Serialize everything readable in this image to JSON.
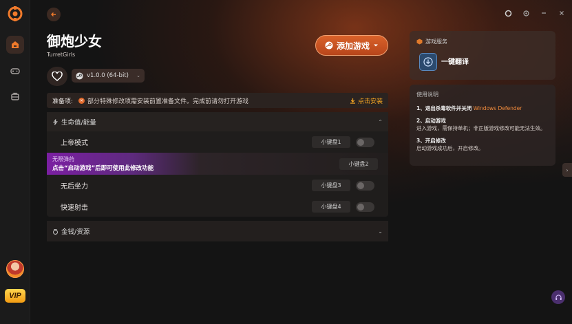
{
  "game": {
    "title": "御炮少女",
    "subtitle": "TurretGirls",
    "add_button": "添加游戏",
    "version": "v1.0.0 (64-bit)"
  },
  "prep": {
    "label": "准备项:",
    "text": "部分特殊修改项需安装前置准备文件。完成前请勿打开游戏",
    "install": "点击安装"
  },
  "sections": {
    "health": {
      "title": "生命值/能量",
      "rows": [
        {
          "label": "上帝模式",
          "key": "小键盘1"
        },
        {
          "label_top": "无限弹药",
          "label_bottom": "点击“启动游戏”后即可使用此修改功能",
          "key": "小键盘2"
        },
        {
          "label": "无后坐力",
          "key": "小键盘3"
        },
        {
          "label": "快速射击",
          "key": "小键盘4"
        }
      ]
    },
    "money": {
      "title": "金钱/资源"
    }
  },
  "service": {
    "title": "游戏服务",
    "translate": "一键翻译"
  },
  "usage": {
    "title": "使用说明",
    "step1_title": "1、退出杀毒软件并关闭",
    "step1_highlight": "Windows Defender",
    "step2_title": "2、启动游戏",
    "step2_text": "进入游戏，需保持单机；非正版游戏修改可能无法生效。",
    "step3_title": "3、开启修改",
    "step3_text": "启动游戏成功后，开启修改。"
  },
  "sidebar": {
    "vip": "VIP"
  },
  "colors": {
    "accent": "#d9622a",
    "highlight_purple": "#7b1fa2",
    "install": "#f5a623"
  }
}
